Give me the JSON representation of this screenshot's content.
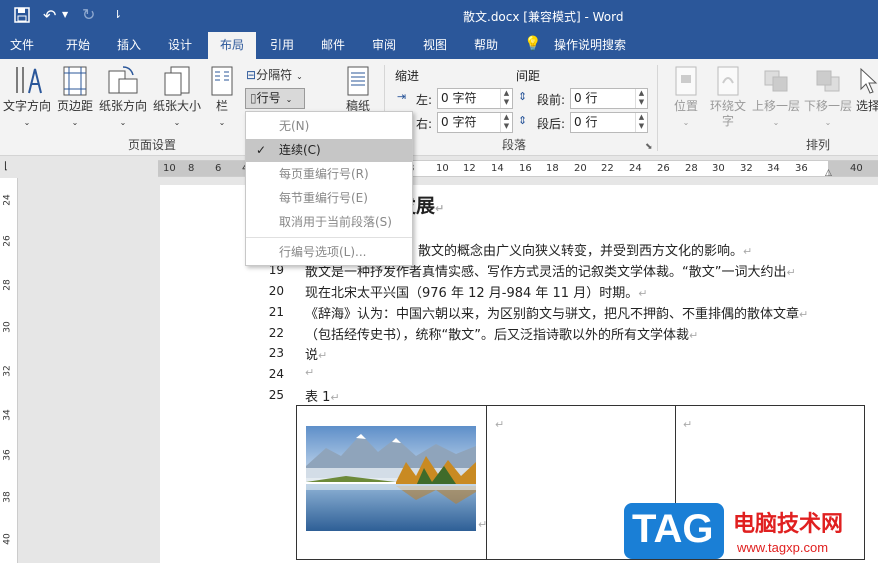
{
  "title_bar": {
    "doc_title": "散文.docx [兼容模式] - Word",
    "save_icon": "save-icon",
    "undo_icon": "undo-icon",
    "redo_icon": "redo-icon",
    "customize_icon": "customize-icon"
  },
  "tabs": [
    {
      "label": "文件"
    },
    {
      "label": "开始"
    },
    {
      "label": "插入"
    },
    {
      "label": "设计"
    },
    {
      "label": "布局",
      "active": true
    },
    {
      "label": "引用"
    },
    {
      "label": "邮件"
    },
    {
      "label": "审阅"
    },
    {
      "label": "视图"
    },
    {
      "label": "帮助"
    },
    {
      "label": "操作说明搜索"
    }
  ],
  "ribbon": {
    "page_setup": {
      "group_label": "页面设置",
      "text_direction": "文字方向",
      "margins": "页边距",
      "orientation": "纸张方向",
      "size": "纸张大小",
      "columns": "栏",
      "breaks": "分隔符",
      "line_numbers": "行号",
      "manuscript": "稿纸"
    },
    "paragraph": {
      "group_label": "段落",
      "indent_label": "缩进",
      "spacing_label": "间距",
      "left_label": "左:",
      "right_label": "右:",
      "before_label": "段前:",
      "after_label": "段后:",
      "left_value": "0 字符",
      "right_value": "0 字符",
      "before_value": "0 行",
      "after_value": "0 行"
    },
    "arrange": {
      "group_label": "排列",
      "position": "位置",
      "wrap_text_1": "环绕文",
      "wrap_text_2": "字",
      "bring_forward": "上移一层",
      "send_backward": "下移一层",
      "select": "选择"
    }
  },
  "line_numbers_menu": {
    "items": [
      {
        "label": "无(N)",
        "checked": false
      },
      {
        "label": "连续(C)",
        "checked": true
      },
      {
        "label": "每页重编行号(R)",
        "checked": false
      },
      {
        "label": "每节重编行号(E)",
        "checked": false
      },
      {
        "label": "取消用于当前段落(S)",
        "checked": false
      },
      {
        "label": "行编号选项(L)...",
        "checked": false
      }
    ]
  },
  "ruler": {
    "h_ticks": [
      "10",
      "8",
      "6",
      "4",
      "2",
      "",
      "2",
      "4",
      "6",
      "8",
      "10",
      "12",
      "14",
      "16",
      "18",
      "20",
      "22",
      "24",
      "26",
      "28",
      "30",
      "32",
      "34",
      "36",
      "",
      "40"
    ],
    "v_ticks": [
      "24",
      "26",
      "28",
      "30",
      "32",
      "34",
      "36",
      "38",
      "40"
    ]
  },
  "document": {
    "heading": "发展",
    "lines": [
      {
        "num": "",
        "text": "散文的概念由广义向狭义转变，并受到西方文化的影响。"
      },
      {
        "num": "19",
        "text": "散文是一种抒发作者真情实感、写作方式灵活的记叙类文学体裁。“散文”一词大约出"
      },
      {
        "num": "20",
        "text": "现在北宋太平兴国（976 年 12 月-984 年 11 月）时期。"
      },
      {
        "num": "21",
        "text": "《辞海》认为：中国六朝以来，为区别韵文与骈文，把凡不押韵、不重排偶的散体文章"
      },
      {
        "num": "22",
        "text": "（包括经传史书），统称“散文”。后又泛指诗歌以外的所有文学体裁"
      },
      {
        "num": "23",
        "text": "说"
      },
      {
        "num": "24",
        "text": ""
      },
      {
        "num": "25",
        "text": "表  1"
      }
    ],
    "table_image": "mountain-lake-photo"
  },
  "watermark": {
    "tag": "TAG",
    "site_name": "电脑技术网",
    "url": "www.tagxp.com"
  },
  "colors": {
    "title_bar": "#2b579a",
    "ribbon": "#f3f3f3",
    "menu_highlight": "#c6c6c6",
    "watermark_blue": "#1a7fd6",
    "watermark_red": "#e02020"
  }
}
